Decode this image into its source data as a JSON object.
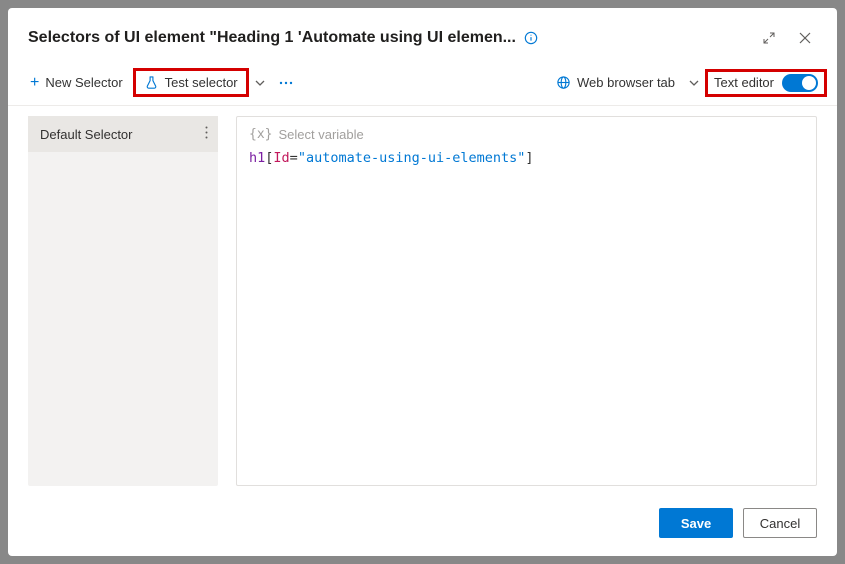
{
  "header": {
    "title": "Selectors of UI element \"Heading 1 'Automate using UI elemen..."
  },
  "toolbar": {
    "new_selector_label": "New Selector",
    "test_selector_label": "Test selector",
    "web_browser_tab_label": "Web browser tab",
    "text_editor_label": "Text editor"
  },
  "sidebar": {
    "items": [
      {
        "label": "Default Selector"
      }
    ]
  },
  "editor": {
    "select_variable_placeholder": "Select variable",
    "code_parts": {
      "tag": "h1",
      "open_br": "[",
      "attr": "Id",
      "eq": "=",
      "value": "\"automate-using-ui-elements\"",
      "close_br": "]"
    }
  },
  "footer": {
    "save_label": "Save",
    "cancel_label": "Cancel"
  }
}
